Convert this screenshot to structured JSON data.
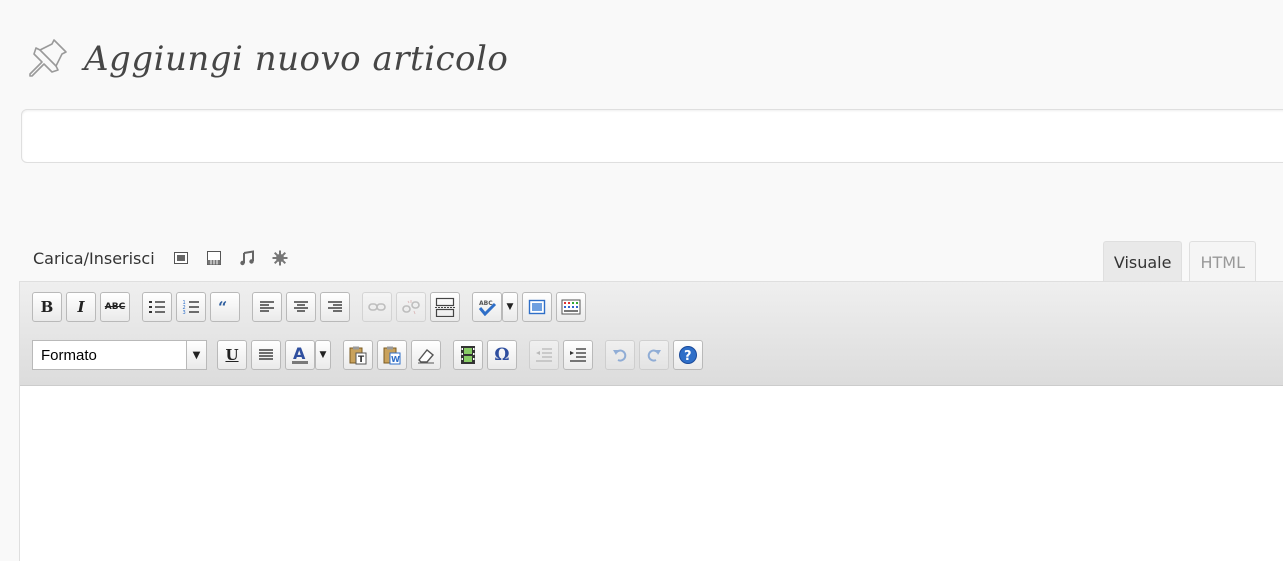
{
  "page": {
    "title": "Aggiungi nuovo articolo"
  },
  "title_input": {
    "value": "",
    "placeholder": ""
  },
  "media": {
    "label": "Carica/Inserisci",
    "icons": [
      "add-image-icon",
      "add-video-icon",
      "add-audio-icon",
      "add-media-icon"
    ]
  },
  "tabs": [
    {
      "label": "Visuale",
      "active": true
    },
    {
      "label": "HTML",
      "active": false
    }
  ],
  "toolbar": {
    "bold_label": "B",
    "italic_label": "I",
    "underline_label": "U",
    "strike_label": "ABC",
    "format_select": {
      "value": "Formato"
    }
  },
  "colors": {
    "toolbar_bg": "#dcdcdc",
    "help_blue": "#2f6fc8",
    "text_color_bar": "#7a7a7a"
  }
}
